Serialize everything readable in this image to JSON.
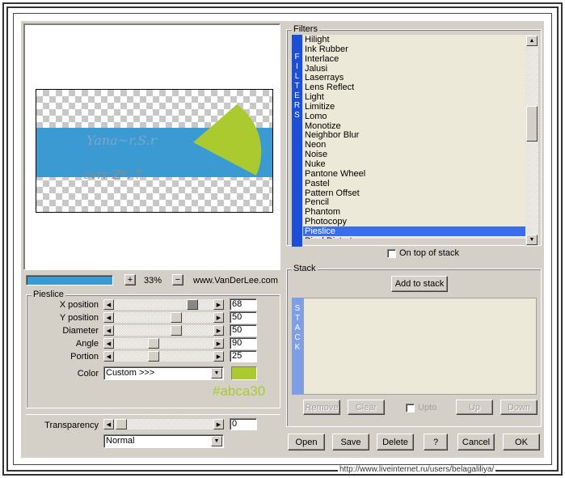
{
  "preview": {
    "zoom": "33%",
    "site": "www.VanDerLee.com",
    "zoom_in": "+",
    "zoom_out": "−"
  },
  "pieslice": {
    "title": "Pieslice",
    "sliders": [
      {
        "label": "X position",
        "value": "68"
      },
      {
        "label": "Y position",
        "value": "50"
      },
      {
        "label": "Diameter",
        "value": "50"
      },
      {
        "label": "Angle",
        "value": "90"
      },
      {
        "label": "Portion",
        "value": "25"
      }
    ],
    "color_label": "Color",
    "color_value": "Custom >>>",
    "swatch_color": "#abca30",
    "swatch_caption": "#abca30"
  },
  "transparency": {
    "label": "Transparency",
    "value": "0",
    "blend": "Normal"
  },
  "filters": {
    "title": "Filters",
    "tab": [
      "F",
      "I",
      "L",
      "T",
      "E",
      "R",
      "S"
    ],
    "items": [
      "Hilight",
      "Ink Rubber",
      "Interlace",
      "Jalusi",
      "Laserrays",
      "Lens Reflect",
      "Light",
      "Limitize",
      "Lomo",
      "Monotize",
      "Neighbor Blur",
      "Neon",
      "Noise",
      "Nuke",
      "Pantone Wheel",
      "Pastel",
      "Pattern Offset",
      "Pencil",
      "Phantom",
      "Photocopy",
      "Pieslice",
      "Pixel Distort"
    ],
    "selected": "Pieslice",
    "on_top": "On top of stack"
  },
  "stack": {
    "title": "Stack",
    "add": "Add to stack",
    "tab": [
      "S",
      "T",
      "A",
      "C",
      "K"
    ],
    "remove": "Remove",
    "clear": "Clear",
    "upto": "Upto",
    "up": "Up",
    "down": "Down"
  },
  "footer": {
    "open": "Open",
    "save": "Save",
    "delete": "Delete",
    "help": "?",
    "cancel": "Cancel",
    "ok": "OK"
  },
  "watermark": "http://www.liveinternet.ru/users/belagaliliya/"
}
